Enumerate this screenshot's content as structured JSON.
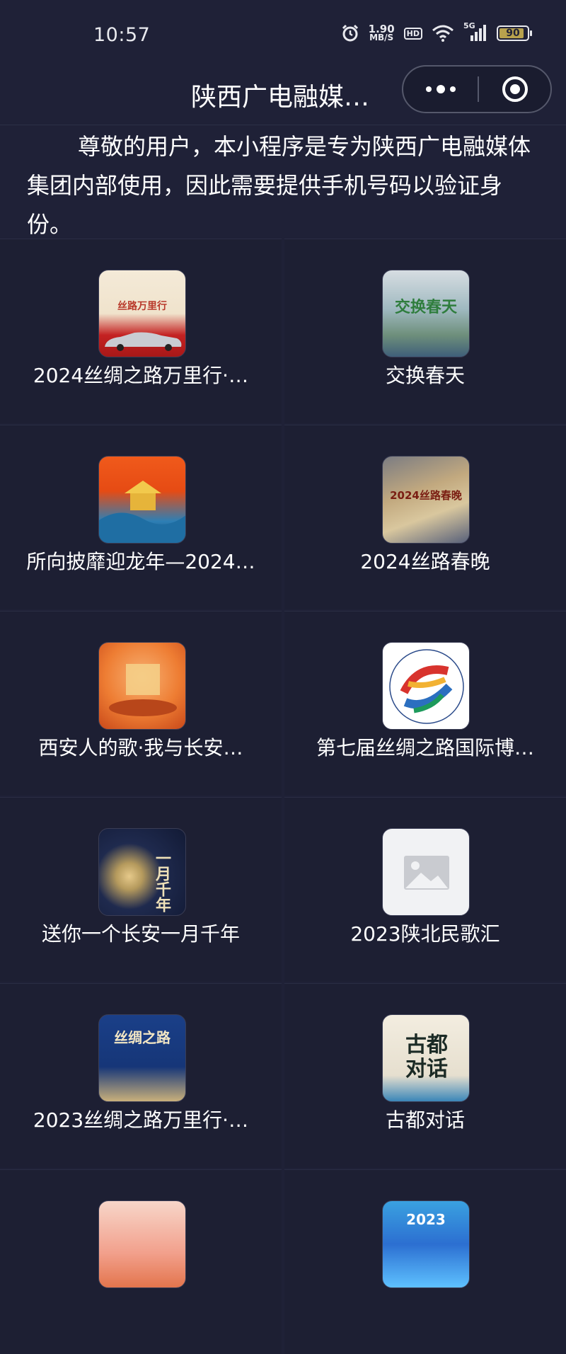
{
  "status_bar": {
    "time": "10:57",
    "net_speed_value": "1.90",
    "net_speed_unit": "MB/S",
    "hd_label": "HD",
    "network_label": "5G",
    "battery_level": "90"
  },
  "header": {
    "title": "陕西广电融媒…"
  },
  "notice": {
    "text": "尊敬的用户，本小程序是专为陕西广电融媒体集团内部使用，因此需要提供手机号码以验证身份。"
  },
  "items": [
    {
      "title": "2024丝绸之路万里行·…",
      "thumb_text": "丝路万里行"
    },
    {
      "title": "交换春天",
      "thumb_text": "交换春天"
    },
    {
      "title": "所向披靡迎龙年—2024…",
      "thumb_text": ""
    },
    {
      "title": "2024丝路春晚",
      "thumb_text": "2024丝路春晚"
    },
    {
      "title": "西安人的歌·我与长安…",
      "thumb_text": ""
    },
    {
      "title": "第七届丝绸之路国际博…",
      "thumb_text": ""
    },
    {
      "title": "送你一个长安一月千年",
      "thumb_text": "一月千年"
    },
    {
      "title": "2023陕北民歌汇",
      "thumb_text": ""
    },
    {
      "title": "2023丝绸之路万里行·…",
      "thumb_text": "丝绸之路"
    },
    {
      "title": "古都对话",
      "thumb_text": "古都对话"
    },
    {
      "title": "",
      "thumb_text": ""
    },
    {
      "title": "",
      "thumb_text": "2023"
    }
  ],
  "colors": {
    "background": "#1f2137",
    "cell": "#1d1f33",
    "text": "#ffffff"
  }
}
